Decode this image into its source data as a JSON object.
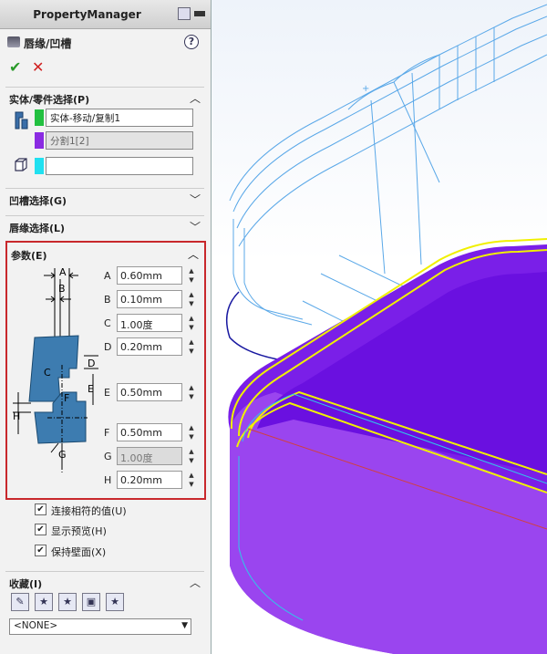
{
  "header": {
    "title": "PropertyManager"
  },
  "feature": {
    "title": "唇缘/凹槽",
    "help": "?"
  },
  "actions": {
    "ok": "✔",
    "cancel": "✕"
  },
  "sections": {
    "body_select": {
      "label": "实体/零件选择(P)",
      "chev": "︿"
    },
    "groove_select": {
      "label": "凹槽选择(G)",
      "chev": "﹀"
    },
    "lip_select": {
      "label": "唇缘选择(L)",
      "chev": "﹀"
    },
    "params": {
      "label": "参数(E)",
      "chev": "︿"
    },
    "favorites": {
      "label": "收藏(I)",
      "chev": "︿"
    }
  },
  "selections": {
    "body1": "实体-移动/复制1",
    "body2": "分割1[2]",
    "face": ""
  },
  "colors": {
    "chip1": "#22c040",
    "chip2": "#8a2be2",
    "chip3": "#20e0f0",
    "accent": "#c8282c",
    "solid": "#7a1fe8"
  },
  "params": [
    {
      "letter": "A",
      "value": "0.60mm",
      "disabled": false
    },
    {
      "letter": "B",
      "value": "0.10mm",
      "disabled": false
    },
    {
      "letter": "C",
      "value": "1.00度",
      "disabled": false
    },
    {
      "letter": "D",
      "value": "0.20mm",
      "disabled": false
    },
    {
      "letter": "E",
      "value": "0.50mm",
      "disabled": false
    },
    {
      "letter": "F",
      "value": "0.50mm",
      "disabled": false
    },
    {
      "letter": "G",
      "value": "1.00度",
      "disabled": true
    },
    {
      "letter": "H",
      "value": "0.20mm",
      "disabled": false
    }
  ],
  "diagram_labels": {
    "a": "A",
    "b": "B",
    "c": "C",
    "d": "D",
    "e": "E",
    "f": "F",
    "g": "G",
    "h": "H"
  },
  "checkboxes": [
    {
      "label": "连接相符的值(U)",
      "checked": "✔"
    },
    {
      "label": "显示预览(H)",
      "checked": "✔"
    },
    {
      "label": "保持壁面(X)",
      "checked": "✔"
    }
  ],
  "favorites": {
    "icons": [
      "wand-icon",
      "star-add-icon",
      "star-delete-icon",
      "save-icon",
      "star-load-icon"
    ],
    "select": "<NONE>",
    "dd": "▼"
  }
}
